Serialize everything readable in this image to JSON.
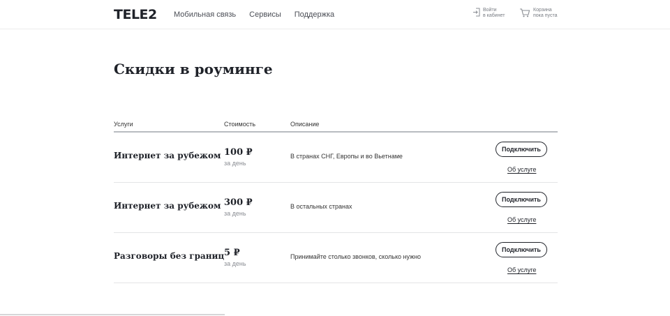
{
  "header": {
    "logo": "TELE2",
    "nav": [
      "Мобильная связь",
      "Сервисы",
      "Поддержка"
    ],
    "login": {
      "line1": "Войти",
      "line2": "в кабинет",
      "icon": "login-icon"
    },
    "cart": {
      "line1": "Корзина",
      "line2": "пока пуста",
      "icon": "cart-icon"
    }
  },
  "page": {
    "title": "Скидки в роуминге"
  },
  "table": {
    "headers": {
      "service": "Услуги",
      "cost": "Стоимость",
      "description": "Описание"
    },
    "rows": [
      {
        "service": "Интернет за рубежом",
        "price": "100 ₽",
        "period": "за день",
        "description": "В странах СНГ, Европы и во Вьетнаме",
        "button": "Подключить",
        "link": "Об услуге"
      },
      {
        "service": "Интернет за рубежом",
        "price": "300 ₽",
        "period": "за день",
        "description": "В остальных странах",
        "button": "Подключить",
        "link": "Об услуге"
      },
      {
        "service": "Разговоры без границ",
        "price": "5 ₽",
        "period": "за день",
        "description": "Принимайте столько звонков, сколько нужно",
        "button": "Подключить",
        "link": "Об услуге"
      }
    ]
  }
}
